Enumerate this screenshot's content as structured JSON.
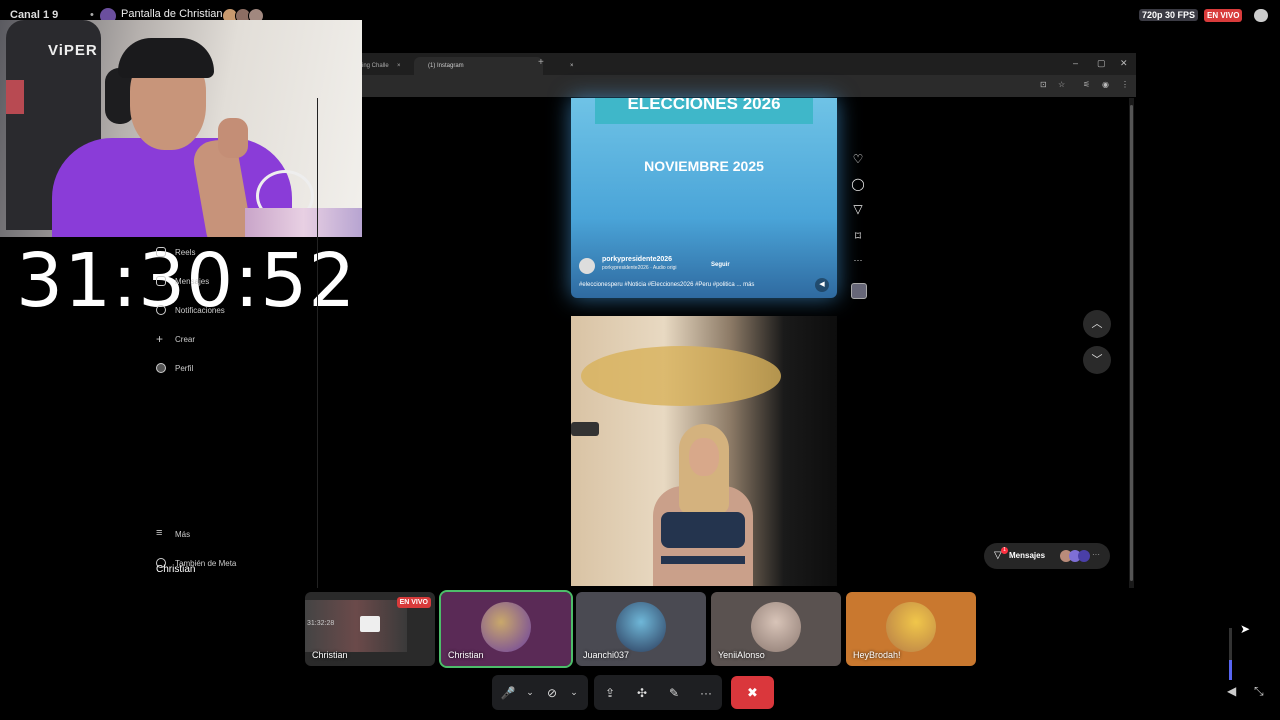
{
  "topbar": {
    "channel": "Canal 1 9",
    "separator": "•",
    "share_label": "Pantalla de Christian",
    "quality": "720p 30 FPS",
    "live": "EN VIVO"
  },
  "webcam": {
    "chair_text": "ViPER"
  },
  "timer": "31:30:52",
  "ig_sidebar": {
    "items": [
      "Reels",
      "Mensajes",
      "Notificaciones",
      "Crear",
      "Perfil"
    ],
    "more": "Más",
    "meta": "También de Meta"
  },
  "stream_owner": "Christian",
  "browser": {
    "tabs": [
      "ing Challe",
      "(1) Instagram"
    ],
    "tab_close": "×",
    "new_tab": "+",
    "window_controls": [
      "–",
      "▢",
      "✕"
    ]
  },
  "post1": {
    "title": "ELECCIONES 2026",
    "subtitle": "NOVIEMBRE 2025",
    "username": "porkypresidente2026",
    "audio": "porkypresidente2026 · Audio origi",
    "follow": "Seguir",
    "hashtags": "#eleccionesperu #Noticia #Elecciones2026 #Peru #politica ... más"
  },
  "post_actions": {
    "like": "♡",
    "comment": "◯",
    "share": "▽",
    "save": "⌑",
    "more": "···"
  },
  "nav": {
    "up": "︿",
    "down": "﹀"
  },
  "messages": {
    "label": "Mensajes",
    "badge": "1",
    "more": "···"
  },
  "participants": [
    {
      "name": "Christian",
      "live": "EN VIVO",
      "timer": "31:32:28",
      "type": "screen"
    },
    {
      "name": "Christian",
      "type": "camera"
    },
    {
      "name": "Juanchi037",
      "type": "avatar"
    },
    {
      "name": "YeniiAlonso",
      "type": "avatar"
    },
    {
      "name": "HeyBrodah!",
      "type": "avatar"
    }
  ],
  "controls": {
    "mic": "🎤",
    "chevron": "⌄",
    "camera": "⊘",
    "screen": "⇪",
    "activities": "✣",
    "soundboard": "✎",
    "more": "···",
    "hangup": "✖"
  },
  "colors": {
    "live_red": "#d83b3b",
    "hangup_red": "#da373c",
    "discord_blurple": "#5865f2",
    "post_blue": "#4aa4d8",
    "purple_shirt": "#8a3cd8"
  },
  "icons": [
    "mic-icon",
    "camera-off-icon",
    "screen-share-icon",
    "activities-icon",
    "soundboard-icon",
    "more-icon",
    "hangup-icon",
    "volume-icon",
    "fullscreen-icon",
    "chat-icon",
    "heart-icon",
    "comment-icon",
    "share-icon",
    "bookmark-icon"
  ]
}
